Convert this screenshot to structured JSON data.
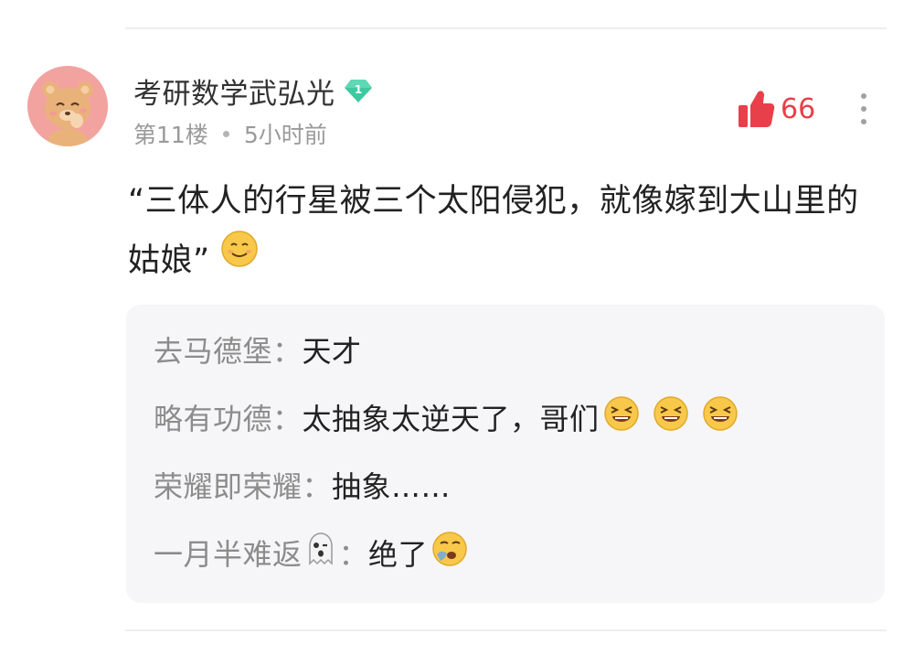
{
  "comment": {
    "username": "考研数学武弘光",
    "level_badge": "1",
    "floor": "第11楼",
    "time_ago": "5小时前",
    "like_count": "66",
    "body_text": "“三体人的行星被三个太阳侵犯，就像嫁到大山里的姑娘”"
  },
  "replies": [
    {
      "author": "去马德堡",
      "separator": "：",
      "text": "天才"
    },
    {
      "author": "略有功德",
      "separator": "：",
      "text": "太抽象太逆天了，哥们"
    },
    {
      "author": "荣耀即荣耀",
      "separator": "：",
      "text": "抽象……"
    },
    {
      "author": "一月半难返",
      "separator": "：",
      "text": "绝了"
    }
  ],
  "colors": {
    "like_red": "#e8404a",
    "badge_green": "#3fc9a0",
    "reply_bg": "#f6f6f8",
    "muted_text": "#9a9a9a"
  },
  "icons": {
    "avatar": "bear-avatar",
    "level_badge": "diamond-badge-icon",
    "like": "thumbs-up-icon",
    "more": "more-vertical-icon",
    "post_emoji": "smile-emoji-icon",
    "laugh_emoji": "laughing-emoji-icon",
    "ghost_emoji": "ghost-emoji-icon",
    "yawn_emoji": "yawning-emoji-icon"
  }
}
